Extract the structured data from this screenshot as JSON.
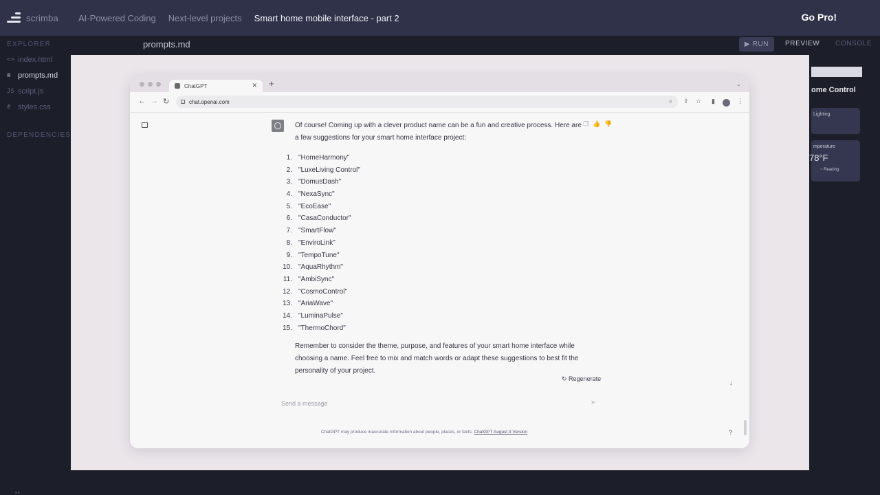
{
  "topbar": {
    "logo_text": "scrimba",
    "breadcrumbs": [
      "AI-Powered Coding",
      "Next-level projects"
    ],
    "current": "Smart home mobile interface - part 2",
    "gopro_label": "Go Pro!"
  },
  "sidebar": {
    "explorer_label": "EXPLORER",
    "files": [
      {
        "icon": "<>",
        "name": "index.html"
      },
      {
        "icon": "≡",
        "name": "prompts.md"
      },
      {
        "icon": "JS",
        "name": "script.js"
      },
      {
        "icon": "#",
        "name": "styles.css"
      }
    ],
    "dependencies_label": "DEPENDENCIES"
  },
  "editor": {
    "tab_label": "prompts.md",
    "run_label": "▶ RUN",
    "preview_label": "PREVIEW",
    "console_label": "CONSOLE"
  },
  "preview": {
    "title": "ome Control",
    "card1_label": "Lighting",
    "card2_label": "mperature",
    "temp_value": "78°F",
    "small_label": "~ Reading"
  },
  "browser": {
    "tab_title": "ChatGPT",
    "new_tab": "+",
    "url": "chat.openai.com"
  },
  "chat": {
    "intro": "Of course! Coming up with a clever product name can be a fun and creative process. Here are a few suggestions for your smart home interface project:",
    "suggestions": [
      {
        "n": "1.",
        "name": "\"HomeHarmony\""
      },
      {
        "n": "2.",
        "name": "\"LuxeLiving Control\""
      },
      {
        "n": "3.",
        "name": "\"DomusDash\""
      },
      {
        "n": "4.",
        "name": "\"NexaSync\""
      },
      {
        "n": "5.",
        "name": "\"EcoEase\""
      },
      {
        "n": "6.",
        "name": "\"CasaConductor\""
      },
      {
        "n": "7.",
        "name": "\"SmartFlow\""
      },
      {
        "n": "8.",
        "name": "\"EnviroLink\""
      },
      {
        "n": "9.",
        "name": "\"TempoTune\""
      },
      {
        "n": "10.",
        "name": "\"AquaRhythm\""
      },
      {
        "n": "11.",
        "name": "\"AmbiSync\""
      },
      {
        "n": "12.",
        "name": "\"CosmoControl\""
      },
      {
        "n": "13.",
        "name": "\"AriaWave\""
      },
      {
        "n": "14.",
        "name": "\"LuminaPulse\""
      },
      {
        "n": "15.",
        "name": "\"ThermoChord\""
      }
    ],
    "outro": "Remember to consider the theme, purpose, and features of your smart home interface while choosing a name. Feel free to mix and match words or adapt these suggestions to best fit the personality of your project.",
    "regenerate_label": "Regenerate",
    "input_placeholder": "Send a message",
    "disclaimer_text": "ChatGPT may produce inaccurate information about people, places, or facts.",
    "disclaimer_link": "ChatGPT August 3 Version",
    "help_label": "?"
  }
}
